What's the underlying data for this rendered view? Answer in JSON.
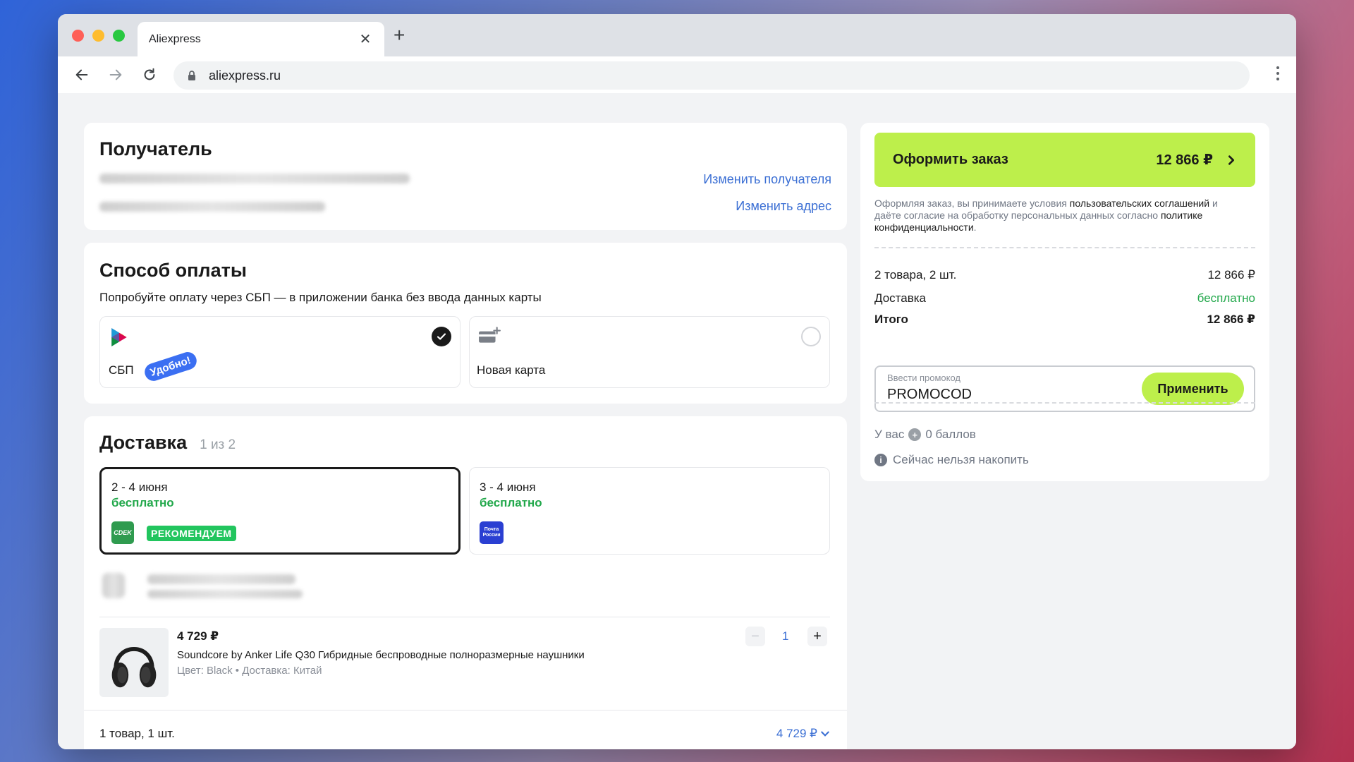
{
  "browser": {
    "tab_title": "Aliexpress",
    "url": "aliexpress.ru"
  },
  "recipient": {
    "title": "Получатель",
    "change_recipient": "Изменить получателя",
    "change_address": "Изменить адрес"
  },
  "payment": {
    "title": "Способ оплаты",
    "hint": "Попробуйте оплату через СБП — в приложении банка без ввода данных карты",
    "options": [
      {
        "label": "СБП",
        "badge": "Удобно!",
        "selected": true
      },
      {
        "label": "Новая карта",
        "selected": false
      }
    ]
  },
  "delivery": {
    "title": "Доставка",
    "counter": "1 из 2",
    "options": [
      {
        "date": "2 - 4 июня",
        "price": "бесплатно",
        "carrier": "CDEK",
        "badge": "РЕКОМЕНДУЕМ",
        "selected": true
      },
      {
        "date": "3 - 4 июня",
        "price": "бесплатно",
        "carrier": "Почта России",
        "selected": false
      }
    ],
    "item": {
      "price": "4 729 ₽",
      "name": "Soundcore by Anker Life Q30 Гибридные беспроводные полноразмерные наушники",
      "meta": "Цвет: Black • Доставка: Китай",
      "quantity": "1"
    },
    "footer_count": "1 товар, 1 шт.",
    "footer_total": "4 729 ₽"
  },
  "summary": {
    "order_button": "Оформить заказ",
    "order_total": "12 866 ₽",
    "terms": {
      "part1": "Оформляя заказ, вы принимаете условия ",
      "link1": "пользовательских соглашений",
      "part2": " и даёте согласие на обработку персональных данных согласно ",
      "link2": "политике конфиденциальности",
      "part3": "."
    },
    "items_label": "2 товара, 2 шт.",
    "items_value": "12 866 ₽",
    "delivery_label": "Доставка",
    "delivery_value": "бесплатно",
    "total_label": "Итого",
    "total_value": "12 866 ₽",
    "promo_placeholder": "Ввести промокод",
    "promo_value": "PROMOCOD",
    "promo_button": "Применить",
    "points_prefix": "У вас",
    "points_value": "0 баллов",
    "points_note": "Сейчас нельзя накопить"
  },
  "colors": {
    "accent_green": "#bdef4b",
    "link_blue": "#3b6fd4",
    "free_green": "#22a84b"
  }
}
